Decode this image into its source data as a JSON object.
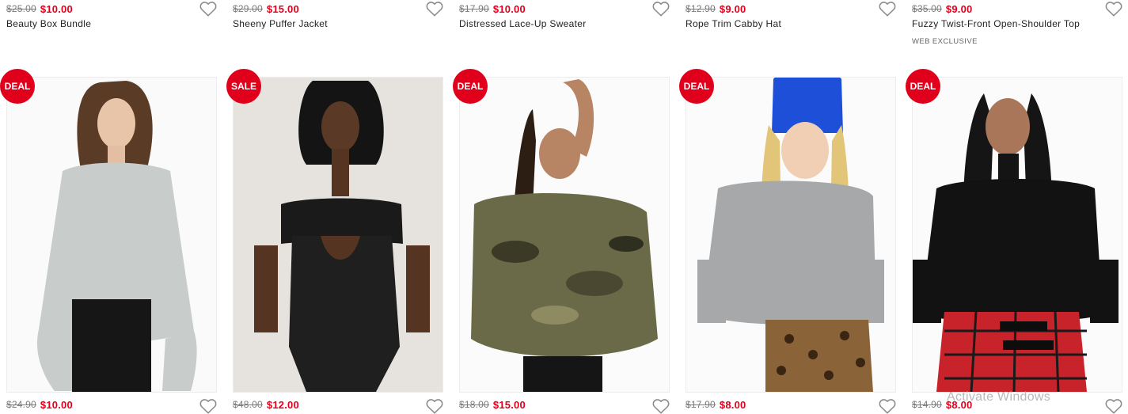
{
  "colors": {
    "sale_red": "#e0001b",
    "strike_gray": "#7a7a7a",
    "text": "#222222",
    "heart_stroke": "#8a8a8a"
  },
  "top_row": [
    {
      "old_price": "$25.00",
      "new_price": "$10.00",
      "name": "Beauty Box Bundle"
    },
    {
      "old_price": "$29.00",
      "new_price": "$15.00",
      "name": "Sheeny Puffer Jacket"
    },
    {
      "old_price": "$17.90",
      "new_price": "$10.00",
      "name": "Distressed Lace-Up Sweater"
    },
    {
      "old_price": "$12.90",
      "new_price": "$9.00",
      "name": "Rope Trim Cabby Hat"
    },
    {
      "old_price": "$35.00",
      "new_price": "$9.00",
      "name": "Fuzzy Twist-Front Open-Shoulder Top",
      "tag": "WEB EXCLUSIVE"
    }
  ],
  "bottom_row": [
    {
      "badge": "DEAL",
      "old_price": "$24.90",
      "new_price": "$10.00"
    },
    {
      "badge": "SALE",
      "old_price": "$48.00",
      "new_price": "$12.00"
    },
    {
      "badge": "DEAL",
      "old_price": "$18.00",
      "new_price": "$15.00"
    },
    {
      "badge": "DEAL",
      "old_price": "$17.90",
      "new_price": "$8.00"
    },
    {
      "badge": "DEAL",
      "old_price": "$14.90",
      "new_price": "$8.00"
    }
  ],
  "heart_icon": "heart-outline-icon",
  "watermark": "Activate Windows"
}
